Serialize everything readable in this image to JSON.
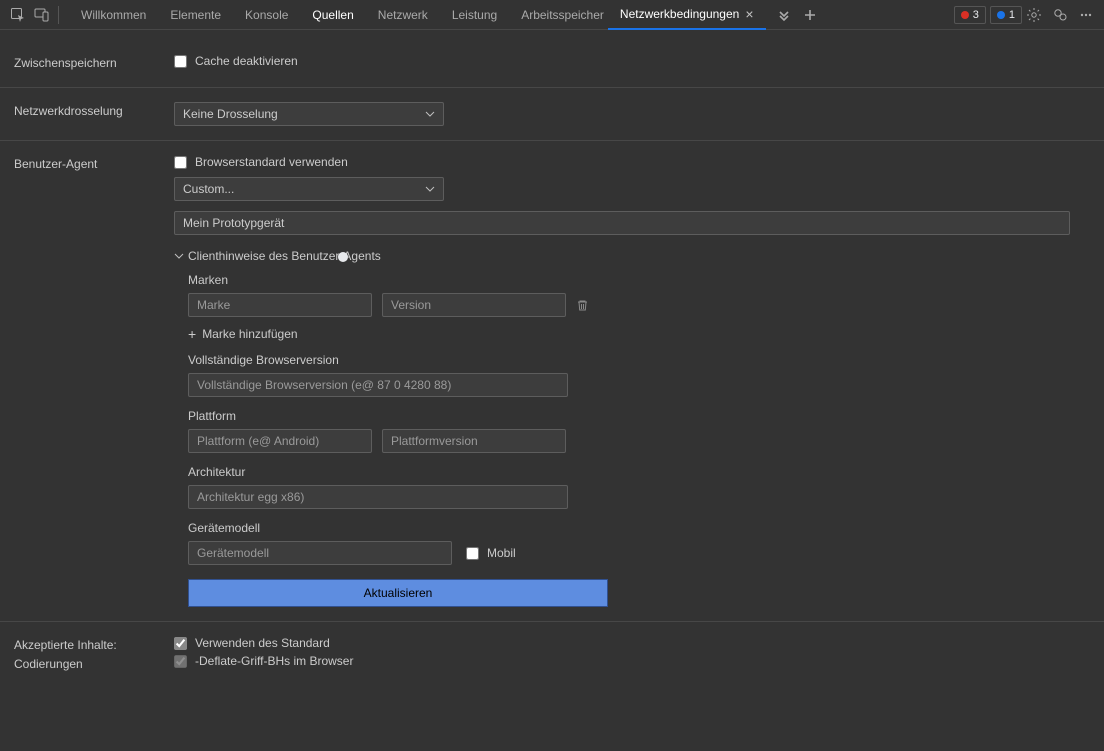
{
  "tabs": {
    "main": [
      "Willkommen",
      "Elemente",
      "Konsole",
      "Quellen",
      "Netzwerk",
      "Leistung",
      "Arbeitsspeicher"
    ],
    "active_main": "Quellen",
    "drawer": "Netzwerkbedingungen"
  },
  "badges": {
    "errors": "3",
    "info": "1"
  },
  "caching": {
    "section": "Zwischenspeichern",
    "disable_label": "Cache deaktivieren"
  },
  "throttling": {
    "section": "Netzwerkdrosselung",
    "selected": "Keine Drosselung"
  },
  "ua": {
    "section": "Benutzer-Agent",
    "use_default": "Browserstandard verwenden",
    "preset_selected": "Custom...",
    "custom_value": "Mein Prototypgerät",
    "hints_header": "Clienthinweise des Benutzer-Agents",
    "brands_label": "Marken",
    "brand_ph": "Marke",
    "version_ph": "Version",
    "add_brand": "Marke hinzufügen",
    "full_ver_label": "Vollständige Browserversion",
    "full_ver_ph": "Vollständige Browserversion (e@ 87 0 4280 88)",
    "platform_label": "Plattform",
    "platform_ph": "Plattform (e@ Android)",
    "platform_ver_ph": "Plattformversion",
    "arch_label": "Architektur",
    "arch_ph": "Architektur egg x86)",
    "model_label": "Gerätemodell",
    "model_ph": "Gerätemodell",
    "mobile_label": "Mobil",
    "update": "Aktualisieren"
  },
  "encodings": {
    "section_l1": "Akzeptierte Inhalte:",
    "section_l2": "Codierungen",
    "use_default": "Verwenden des Standard",
    "deflate": "-Deflate-Griff-BHs im Browser"
  }
}
